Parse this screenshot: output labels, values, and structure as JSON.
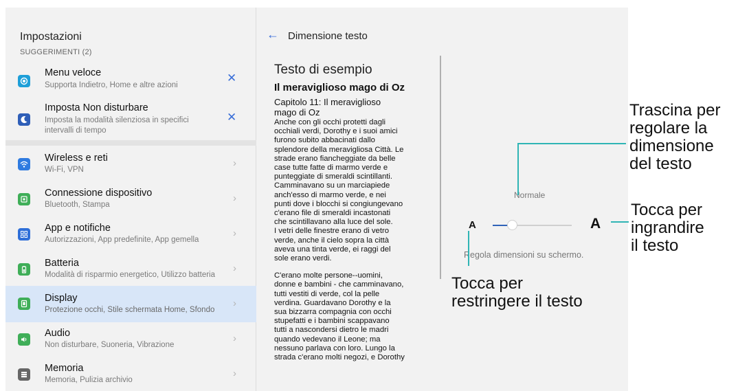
{
  "left": {
    "title": "Impostazioni",
    "suggestions_header": "SUGGERIMENTI (2)",
    "suggestions": [
      {
        "title": "Menu veloce",
        "subtitle_lines": [
          "Supporta Indietro, Home e altre azioni"
        ],
        "icon": "target-icon",
        "color": "#1e9fd8"
      },
      {
        "title": "Imposta Non disturbare",
        "subtitle_lines": [
          "Imposta la modalità silenziosa in specifici",
          "intervalli di tempo"
        ],
        "icon": "moon-icon",
        "color": "#2f5fb8"
      }
    ],
    "menu": [
      {
        "title": "Wireless e reti",
        "subtitle": "Wi-Fi, VPN",
        "icon": "wifi-icon",
        "color": "#2f7be0",
        "active": false
      },
      {
        "title": "Connessione dispositivo",
        "subtitle": "Bluetooth, Stampa",
        "icon": "device-connection-icon",
        "color": "#3fae58",
        "active": false
      },
      {
        "title": "App e notifiche",
        "subtitle": "Autorizzazioni, App predefinite, App gemella",
        "icon": "apps-icon",
        "color": "#2f6fd8",
        "active": false
      },
      {
        "title": "Batteria",
        "subtitle": "Modalità di risparmio energetico, Utilizzo batteria",
        "icon": "battery-icon",
        "color": "#3fae58",
        "active": false
      },
      {
        "title": "Display",
        "subtitle": "Protezione occhi, Stile schermata Home, Sfondo",
        "icon": "display-icon",
        "color": "#3fae58",
        "active": true
      },
      {
        "title": "Audio",
        "subtitle": "Non disturbare, Suoneria, Vibrazione",
        "icon": "speaker-icon",
        "color": "#3fae58",
        "active": false
      },
      {
        "title": "Memoria",
        "subtitle": "Memoria, Pulizia archivio",
        "icon": "storage-icon",
        "color": "#666666",
        "active": false
      }
    ]
  },
  "right": {
    "title": "Dimensione testo",
    "preview": {
      "heading": "Testo di esempio",
      "subheading": "Il meraviglioso mago di Oz",
      "chapter_lines": [
        "Capitolo 11: Il meraviglioso",
        "mago di Oz"
      ],
      "paragraph1_lines": [
        "Anche con gli occhi protetti dagli",
        "occhiali verdi, Dorothy e i suoi amici",
        "furono subito abbacinati dallo",
        "splendore della meravigliosa Città. Le",
        "strade erano fiancheggiate da belle",
        "case tutte fatte di marmo verde e",
        "punteggiate di smeraldi scintillanti.",
        "Camminavano su un marciapiede",
        "anch'esso di marmo verde, e nei",
        "punti dove i blocchi si congiungevano",
        "c'erano file di smeraldi incastonati",
        "che scintillavano alla luce del sole.",
        "I vetri delle finestre erano di vetro",
        "verde, anche il cielo sopra la città",
        "aveva una tinta verde, ei raggi del",
        "sole erano verdi."
      ],
      "paragraph2_lines": [
        "C'erano molte persone--uomini,",
        "donne e bambini - che camminavano,",
        "tutti vestiti di verde, col la pelle",
        "verdina. Guardavano Dorothy e la",
        "sua bizzarra compagnia con occhi",
        "stupefatti e i bambini scappavano",
        "tutti a nascondersi dietro le madri",
        "quando vedevano il Leone; ma",
        "nessuno parlava con loro. Lungo la",
        "strada c'erano molti negozi, e Dorothy"
      ]
    },
    "size_label": "Normale",
    "small_a": "A",
    "big_a": "A",
    "slider_level": 0.25,
    "adjust_text": "Regola dimensioni su schermo."
  },
  "annotations": {
    "drag": [
      "Trascina per",
      "regolare la",
      "dimensione",
      "del testo"
    ],
    "enlarge": [
      "Tocca per",
      "ingrandire",
      "il testo"
    ],
    "shrink": [
      "Tocca per",
      "restringere il testo"
    ]
  },
  "colors": {
    "accent": "#3a6fd8",
    "callout": "#2fb5b5",
    "active_row": "#d8e6f8"
  }
}
